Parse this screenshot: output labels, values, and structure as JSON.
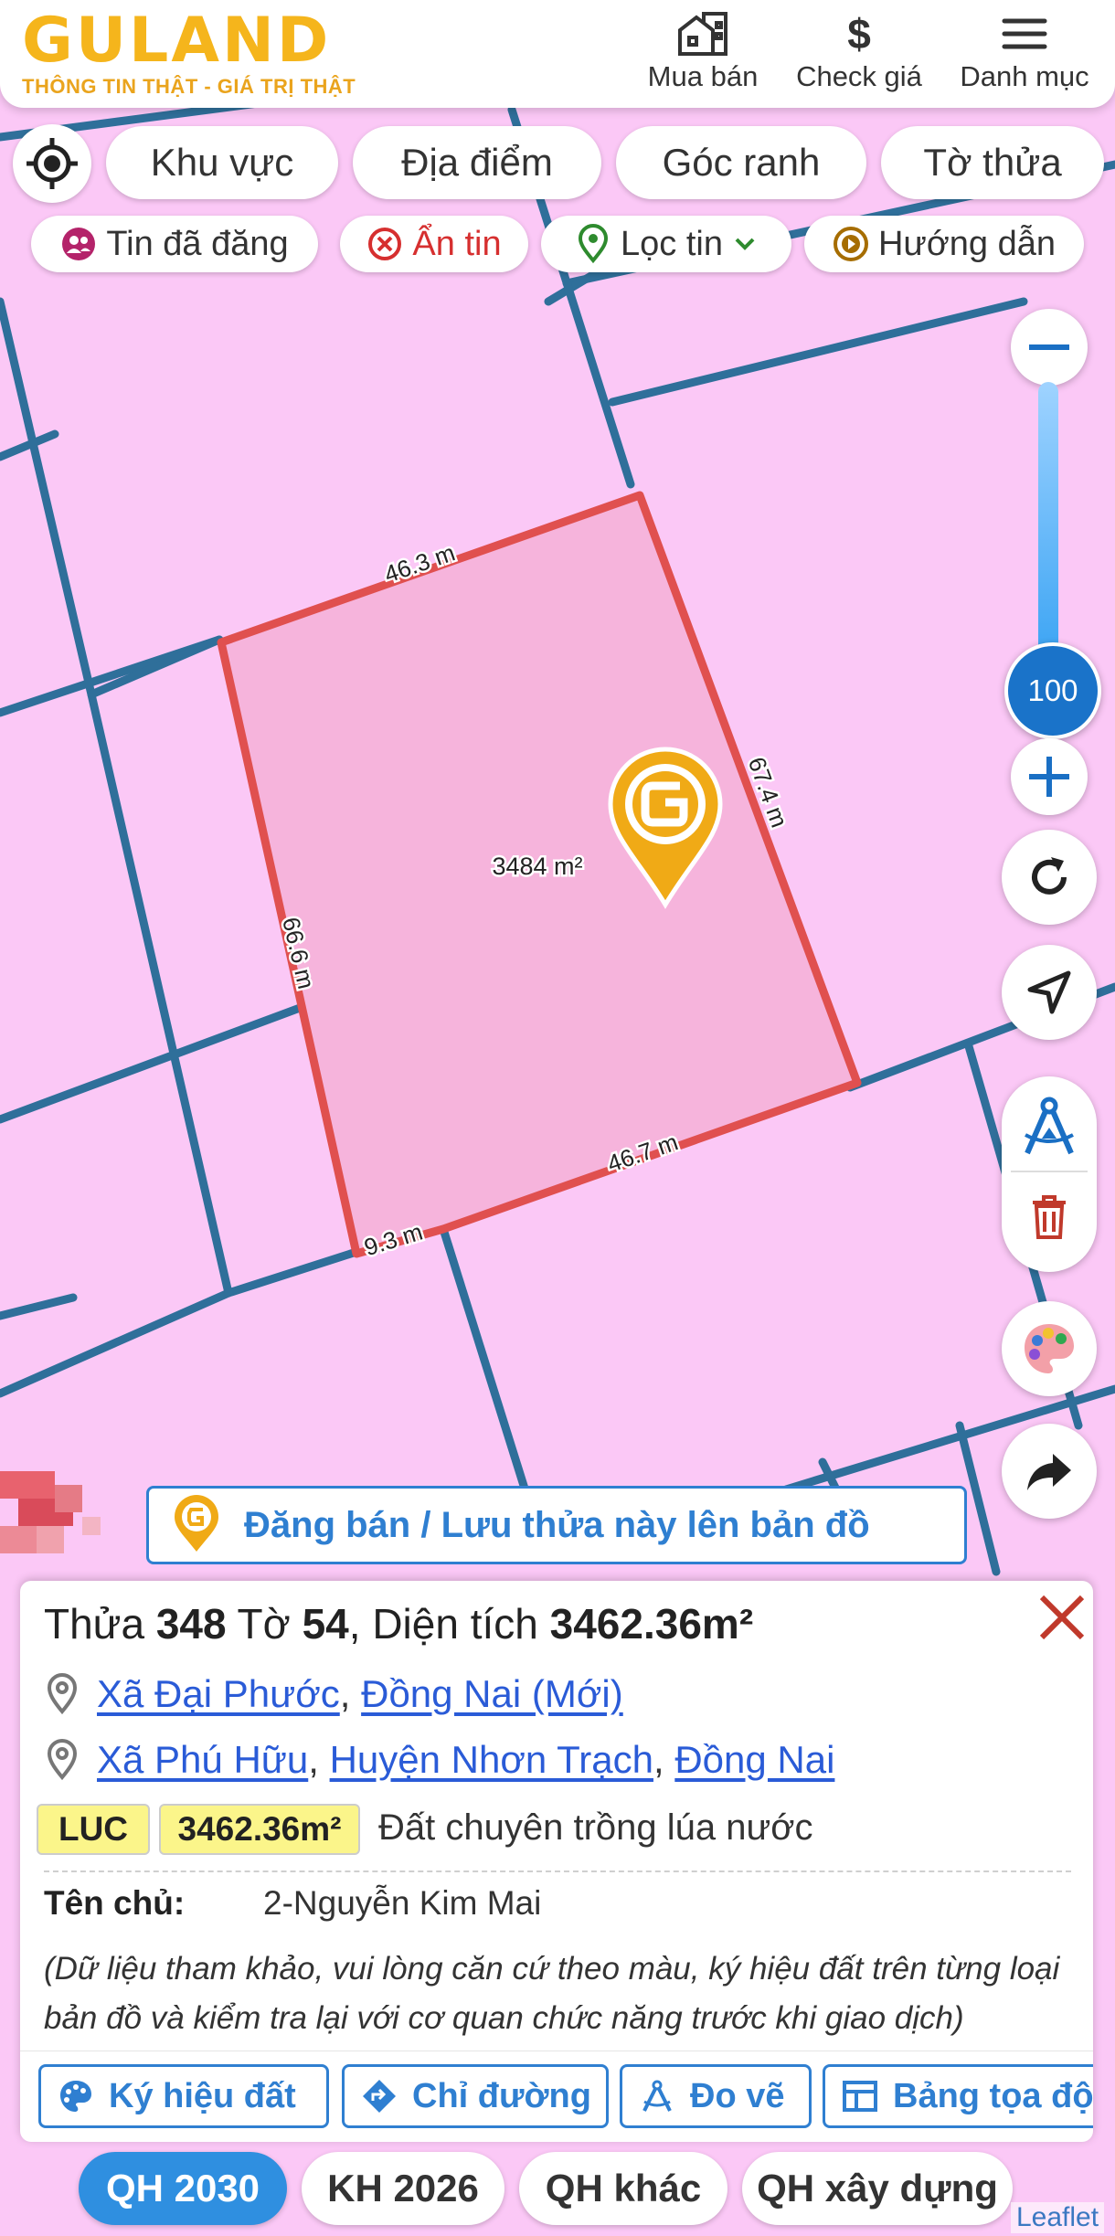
{
  "header": {
    "brand": "GULAND",
    "tagline": "THÔNG TIN THẬT - GIÁ TRỊ THẬT",
    "nav": [
      {
        "label": "Mua bán",
        "icon": "building-icon"
      },
      {
        "label": "Check giá",
        "icon": "dollar-icon"
      },
      {
        "label": "Danh mục",
        "icon": "menu-icon"
      }
    ]
  },
  "filters": {
    "row1": [
      "Khu vực",
      "Địa điểm",
      "Góc ranh",
      "Tờ thửa"
    ],
    "row2": [
      {
        "label": "Tin đã đăng",
        "icon": "user-group-icon",
        "color": "#b4236a"
      },
      {
        "label": "Ẩn tin",
        "icon": "close-circle-icon",
        "color": "#d62f2f"
      },
      {
        "label": "Lọc tin",
        "icon": "pin-icon",
        "color": "#2e8b2e"
      },
      {
        "label": "Hướng dẫn",
        "icon": "play-circle-icon",
        "color": "#a66d00"
      }
    ]
  },
  "map": {
    "zoom": "100",
    "parcel": {
      "area_label": "3484 m²",
      "edges": [
        "46.3 m",
        "67.4 m",
        "46.7 m",
        "9.3 m",
        "66.6 m"
      ]
    },
    "post_button": "Đăng bán / Lưu thửa này lên bản đồ",
    "attribution": "Leaflet"
  },
  "colors": {
    "map_bg": "#fbc8f6",
    "parcel_fill": "#f6b4dc",
    "parcel_stroke": "#e0504f",
    "grid_line": "#2f6f9a",
    "accent": "#2f7fd1",
    "brand": "#f5b51c"
  },
  "panel": {
    "title": {
      "thua_label": "Thửa ",
      "thua": "348",
      "to_label": " Tờ ",
      "to": "54",
      "area_label": ", Diện tích ",
      "area": "3462.36m²"
    },
    "location_new": {
      "commune": "Xã Đại Phước",
      "province": "Đồng Nai (Mới)"
    },
    "location_old": {
      "commune": "Xã Phú Hữu",
      "district": "Huyện Nhơn Trạch",
      "province": "Đồng Nai"
    },
    "land_code": "LUC",
    "land_area": "3462.36m²",
    "land_type": "Đất chuyên trồng lúa nước",
    "owner_label": "Tên chủ:",
    "owner": "2-Nguyễn Kim Mai",
    "note": "(Dữ liệu tham khảo, vui lòng căn cứ theo màu, ký hiệu đất trên từng loại bản đồ và kiểm tra lại với cơ quan chức năng trước khi giao dịch)",
    "actions": [
      "Ký hiệu đất",
      "Chỉ đường",
      "Đo vẽ",
      "Bảng tọa độ"
    ]
  },
  "tabs": [
    {
      "label": "QH 2030",
      "active": true
    },
    {
      "label": "KH 2026",
      "active": false
    },
    {
      "label": "QH khác",
      "active": false
    },
    {
      "label": "QH xây dựng",
      "active": false
    }
  ]
}
